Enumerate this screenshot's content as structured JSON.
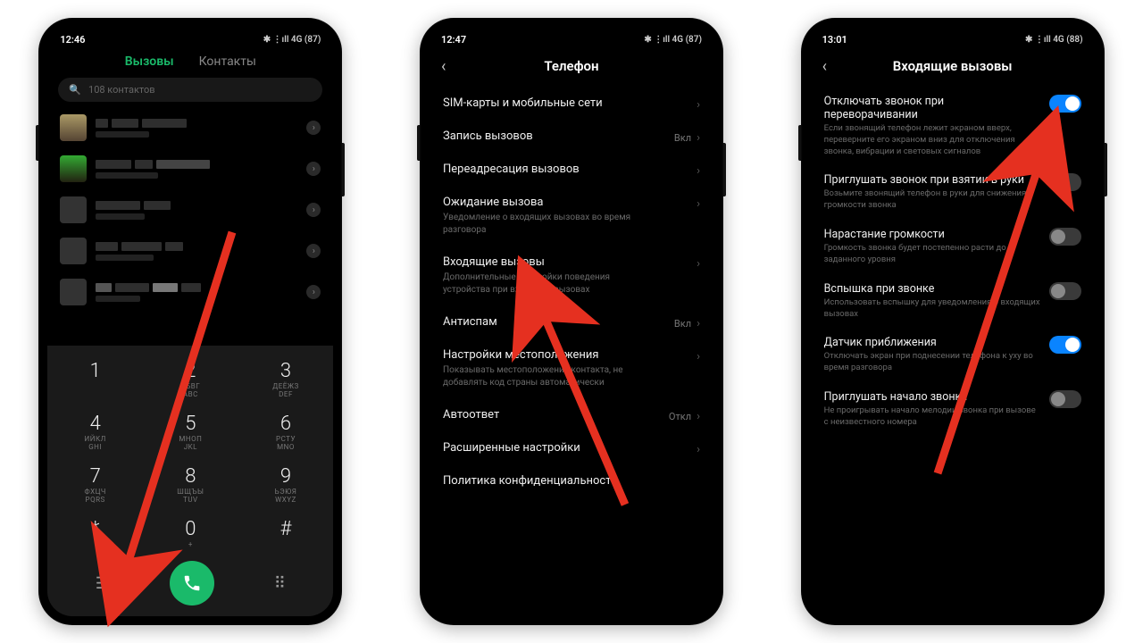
{
  "phone1": {
    "time": "12:46",
    "status": "✱ ⋮ıll 4G (87)",
    "tab_calls": "Вызовы",
    "tab_contacts": "Контакты",
    "search_placeholder": "108 контактов",
    "keys": [
      {
        "n": "1",
        "s": ""
      },
      {
        "n": "2",
        "s": "АБВГ\nABC"
      },
      {
        "n": "3",
        "s": "ДЕЁЖЗ\nDEF"
      },
      {
        "n": "4",
        "s": "ИЙКЛ\nGHI"
      },
      {
        "n": "5",
        "s": "МНОП\nJKL"
      },
      {
        "n": "6",
        "s": "РСТУ\nMNO"
      },
      {
        "n": "7",
        "s": "ФХЦЧ\nPQRS"
      },
      {
        "n": "8",
        "s": "ШЩЪЫ\nTUV"
      },
      {
        "n": "9",
        "s": "ЬЭЮЯ\nWXYZ"
      },
      {
        "n": "*",
        "s": ""
      },
      {
        "n": "0",
        "s": "+"
      },
      {
        "n": "#",
        "s": ""
      }
    ]
  },
  "phone2": {
    "time": "12:47",
    "status": "✱ ⋮ıll 4G (87)",
    "title": "Телефон",
    "items": [
      {
        "label": "SIM-карты и мобильные сети",
        "desc": "",
        "side": "",
        "arrow": true
      },
      {
        "label": "Запись вызовов",
        "desc": "",
        "side": "Вкл",
        "arrow": true
      },
      {
        "label": "Переадресация вызовов",
        "desc": "",
        "side": "",
        "arrow": true
      },
      {
        "label": "Ожидание вызова",
        "desc": "Уведомление о входящих вызовах во время разговора",
        "side": "",
        "arrow": true
      },
      {
        "label": "Входящие вызовы",
        "desc": "Дополнительные настройки поведения устройства при входящих вызовах",
        "side": "",
        "arrow": true
      },
      {
        "label": "Антиспам",
        "desc": "",
        "side": "Вкл",
        "arrow": true
      },
      {
        "label": "Настройки местоположения",
        "desc": "Показывать местоположение контакта, не добавлять код страны автоматически",
        "side": "",
        "arrow": true
      },
      {
        "label": "Автоответ",
        "desc": "",
        "side": "Откл",
        "arrow": true
      },
      {
        "label": "Расширенные настройки",
        "desc": "",
        "side": "",
        "arrow": true
      },
      {
        "label": "Политика конфиденциальности",
        "desc": "",
        "side": "",
        "arrow": false
      }
    ]
  },
  "phone3": {
    "time": "13:01",
    "status": "✱ ⋮ıll 4G (88)",
    "title": "Входящие вызовы",
    "items": [
      {
        "label": "Отключать звонок при переворачивании",
        "desc": "Если звонящий телефон лежит экраном вверх, переверните его экраном вниз для отключения звонка, вибрации и световых сигналов",
        "on": true
      },
      {
        "label": "Приглушать звонок при взятии в руки",
        "desc": "Возьмите звонящий телефон в руки для снижения громкости звонка",
        "on": false
      },
      {
        "label": "Нарастание громкости",
        "desc": "Громкость звонка будет постепенно расти до заданного уровня",
        "on": false
      },
      {
        "label": "Вспышка при звонке",
        "desc": "Использовать вспышку для уведомления о входящих вызовах",
        "on": false
      },
      {
        "label": "Датчик приближения",
        "desc": "Отключать экран при поднесении телефона к уху во время разговора",
        "on": true
      },
      {
        "label": "Приглушать начало звонка",
        "desc": "Не проигрывать начало мелодии звонка при вызове с неизвестного номера",
        "on": false
      }
    ]
  }
}
